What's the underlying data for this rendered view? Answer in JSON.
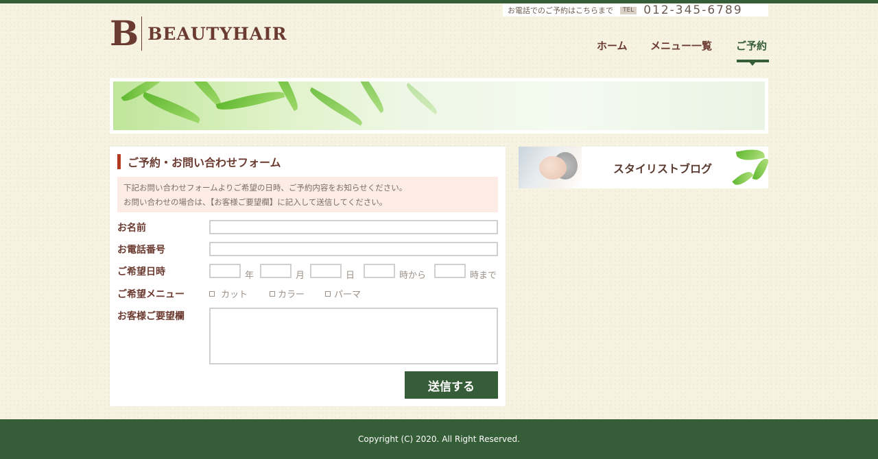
{
  "header": {
    "logo_letter": "B",
    "logo_text": "BEAUTYHAIR",
    "tel_note": "お電話でのご予約はこちらまで",
    "tel_badge": "TEL",
    "tel_number": "012-345-6789"
  },
  "nav": {
    "items": [
      {
        "label": "ホーム",
        "active": false
      },
      {
        "label": "メニュー一覧",
        "active": false
      },
      {
        "label": "ご予約",
        "active": true
      }
    ]
  },
  "form": {
    "title": "ご予約・お問い合わせフォーム",
    "notice_line1": "下記お問い合わせフォームよりご希望の日時、ご予約内容をお知らせください。",
    "notice_line2": "お問い合わせの場合は、【お客様ご要望欄】に記入して送信してください。",
    "labels": {
      "name": "お名前",
      "phone": "お電話番号",
      "date": "ご希望日時",
      "menu": "ご希望メニュー",
      "request": "お客様ご要望欄"
    },
    "values": {
      "name": "",
      "phone": "",
      "year": "",
      "month": "",
      "day": "",
      "time_from": "",
      "time_to": "",
      "request": ""
    },
    "date_units": {
      "year": "年",
      "month": "月",
      "day": "日",
      "from": "時から",
      "to": "時まで"
    },
    "menu_options": [
      {
        "label": "カット",
        "checked": false
      },
      {
        "label": "カラー",
        "checked": false
      },
      {
        "label": "パーマ",
        "checked": false
      }
    ],
    "submit_label": "送信する"
  },
  "sidebar": {
    "blog_label": "スタイリストブログ"
  },
  "footer": {
    "copyright": "Copyright (C) 2020. All Right Reserved."
  },
  "colors": {
    "brand_green": "#355d37",
    "brand_brown": "#6b3a30",
    "accent_red": "#b23a1e",
    "notice_bg": "#fdece6"
  }
}
